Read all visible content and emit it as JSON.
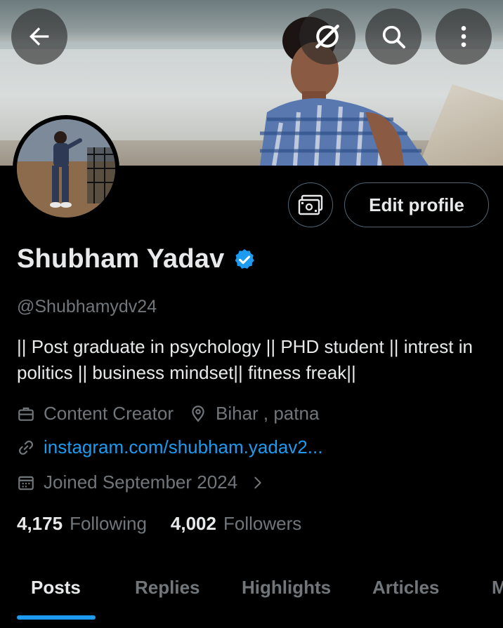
{
  "profile": {
    "name": "Shubham Yadav",
    "handle": "@Shubhamydv24",
    "bio": "|| Post graduate in psychology || PHD student || intrest in politics || business mindset|| fitness freak||",
    "category": "Content Creator",
    "location": "Bihar , patna",
    "website": "instagram.com/shubham.yadav2...",
    "joined": "Joined September 2024"
  },
  "stats": {
    "following_count": "4,175",
    "following_label": "Following",
    "followers_count": "4,002",
    "followers_label": "Followers"
  },
  "actions": {
    "edit_profile_label": "Edit profile"
  },
  "tabs": [
    {
      "label": "Posts",
      "active": true
    },
    {
      "label": "Replies",
      "active": false
    },
    {
      "label": "Highlights",
      "active": false
    },
    {
      "label": "Articles",
      "active": false
    },
    {
      "label": "M",
      "active": false
    }
  ],
  "icons": {
    "back": "arrow-left-icon",
    "grok": "grok-icon",
    "search": "search-icon",
    "more": "more-vertical-icon",
    "verified": "verified-badge-icon",
    "money": "money-icon",
    "category": "briefcase-icon",
    "location": "location-pin-icon",
    "website": "link-icon",
    "joined": "calendar-icon",
    "chevron": "chevron-right-icon"
  },
  "colors": {
    "accent": "#1d9bf0",
    "text_primary": "#e7e9ea",
    "text_secondary": "#71767b",
    "border": "#536471",
    "background": "#000000"
  }
}
